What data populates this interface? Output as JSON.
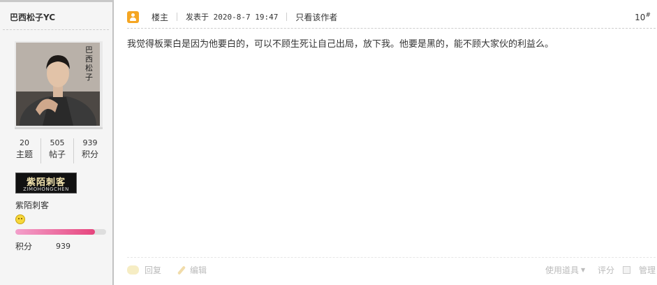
{
  "sidebar": {
    "username": "巴西松子YC",
    "avatar_caption": "巴西松子",
    "stats": [
      {
        "value": "20",
        "label": "主题"
      },
      {
        "value": "505",
        "label": "帖子"
      },
      {
        "value": "939",
        "label": "积分"
      }
    ],
    "medal": {
      "main": "紫陌刺客",
      "sub": "ZIMOHONGCHEN"
    },
    "group_name": "紫陌刺客",
    "progress_fraction": 0.88,
    "credit_label": "积分",
    "credit_value": "939"
  },
  "post": {
    "role": "楼主",
    "posted_at": "发表于 2020-8-7 19:47",
    "only_author": "只看该作者",
    "floor": "10",
    "floor_suffix": "#",
    "content": "我觉得板栗白是因为他要白的，可以不顾生死让自己出局，放下我。他要是黑的，能不顾大家伙的利益么。"
  },
  "footer": {
    "reply": "回复",
    "edit": "编辑",
    "tools": "使用道具",
    "rate": "评分",
    "manage": "管理"
  }
}
